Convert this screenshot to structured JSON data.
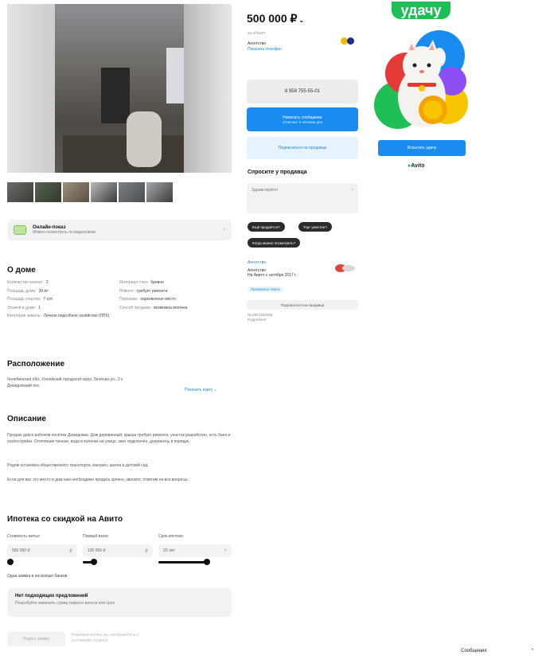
{
  "listing": {
    "price": "500 000 ₽",
    "price_caret": "⌄",
    "price_sub": "за объект",
    "seller_name": "Агентство",
    "seller_link": "Показать телефон",
    "phone_button": "8 958 755-55-01",
    "message_button": "Написать сообщение",
    "message_button_sub": "Отвечает в течение дня",
    "notify_button": "Подписаться на продавца"
  },
  "gallery": {
    "thumb_count": 6
  },
  "online_show": {
    "title": "Онлайн-показ",
    "subtitle": "Можно посмотреть по видеосвязи"
  },
  "about_house": {
    "heading": "О доме",
    "left": [
      {
        "k": "Количество комнат:",
        "v": "2"
      },
      {
        "k": "Площадь дома:",
        "v": "39 м²"
      },
      {
        "k": "Площадь участка:",
        "v": "7 сот."
      },
      {
        "k": "Этажей в доме:",
        "v": "1"
      },
      {
        "k": "Категория земель:",
        "v": "Личное подсобное хозяйство (ЛПХ)"
      }
    ],
    "right": [
      {
        "k": "Материал стен:",
        "v": "бревно"
      },
      {
        "k": "Ремонт:",
        "v": "требует ремонта"
      },
      {
        "k": "Парковка:",
        "v": "парковочное место"
      },
      {
        "k": "Способ продажи:",
        "v": "возможна ипотека"
      }
    ]
  },
  "location": {
    "heading": "Расположение",
    "address": "Челябинская обл., Копейский городской округ, Зелёная ул., 2 к",
    "district": "Демидовский пос.",
    "map_link": "Показать карту ⌄"
  },
  "description": {
    "heading": "Описание",
    "paragraphs": [
      "Продаю дом в рабочем посёлке Демидовка. Дом деревянный, крыша требует ремонта, участок разработан, есть баня и хозпостройки. Отопление печное, вода в колонке на улице, свет подключён, документы в порядке.",
      "Рядом остановка общественного транспорта, магазин, школа и детский сад.",
      "Если для вас это место и дом нам необходимо продать срочно, звоните, ответим на все вопросы."
    ]
  },
  "mortgage": {
    "heading": "Ипотека со скидкой на Авито",
    "labels": [
      "Стоимость жилья",
      "Первый взнос",
      "Срок ипотеки"
    ],
    "fields": [
      "500 000 ₽",
      "100 000 ₽",
      "20 лет"
    ],
    "term_label": "Одна заявка в несколько банков",
    "no_offers_title": "Нет подходящих предложений",
    "no_offers_sub": "Попробуйте изменить сумму первого взноса или срок",
    "apply_button": "Подать заявку",
    "apply_note": "Нажимая кнопку, вы соглашаетесь с условиями сервиса"
  },
  "ask": {
    "title": "Спросите у продавца",
    "placeholder": "Здравствуйте!",
    "chips": [
      "Ещё продаётся?",
      "Торг уместен?",
      "Когда можно посмотреть?"
    ]
  },
  "agent": {
    "label": "Агентство",
    "name_line1": "Агентство",
    "name_line2": "На Авито с октября 2017 г.",
    "docs": "Проверено Авито",
    "subscribe": "Подписаться на продавца",
    "ad_number": "№ 2914183406",
    "ad_meta": "Подробнее"
  },
  "ad": {
    "headline": "удачу",
    "button": "Испытать удачу",
    "logo": "Avito"
  },
  "messenger": {
    "label": "Сообщения",
    "chev": "⌃"
  },
  "colors": {
    "accent": "#1a8cf0",
    "ad_green": "#1ebf57"
  }
}
